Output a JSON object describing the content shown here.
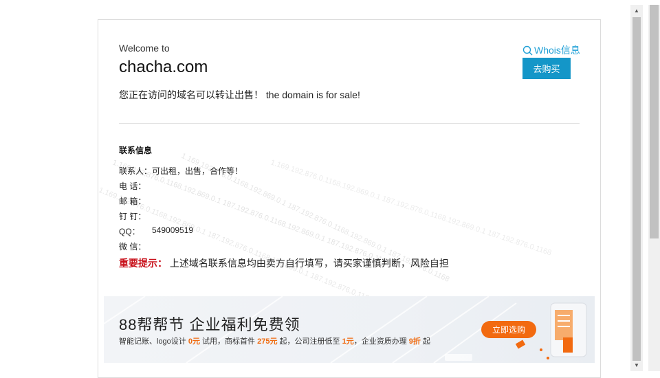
{
  "header": {
    "welcome": "Welcome to",
    "domain": "chacha.com",
    "sale_text": "您正在访问的域名可以转让出售！  the domain is for sale!",
    "whois_label": "Whois信息",
    "buy_label": "去购买"
  },
  "contact": {
    "title": "联系信息",
    "rows": [
      {
        "label": "联系人：",
        "value": "可出租，出售，合作等！"
      },
      {
        "label": "电 话：",
        "value": ""
      },
      {
        "label": "邮 箱：",
        "value": ""
      },
      {
        "label": "钉 钉：",
        "value": ""
      },
      {
        "label": "QQ：",
        "value": "549009519"
      },
      {
        "label": "微 信：",
        "value": ""
      }
    ],
    "notice_label": "重要提示：",
    "notice_text": "上述域名联系信息均由卖方自行填写，请买家谨慎判断，风险自担"
  },
  "banner": {
    "title": "88帮帮节 企业福利免费领",
    "sub_parts": [
      "智能记账、logo设计 ",
      "0元",
      " 试用，商标首件 ",
      "275元",
      " 起，公司注册低至 ",
      "1元",
      "，企业资质办理 ",
      "9折",
      " 起"
    ],
    "button_label": "立即选购"
  },
  "watermark_text": "1.169.192.876.0.1168.192.869.0.1 187.192.876.0.1168.192.869.0.1 187.192.876.0.1168",
  "colors": {
    "accent_blue": "#1496c8",
    "link_blue": "#1e9fd6",
    "notice_red": "#c8101a",
    "banner_orange": "#f26a10"
  },
  "icons": {
    "whois": "search-icon",
    "scroll_up": "chevron-up-icon",
    "scroll_down": "chevron-down-icon"
  }
}
